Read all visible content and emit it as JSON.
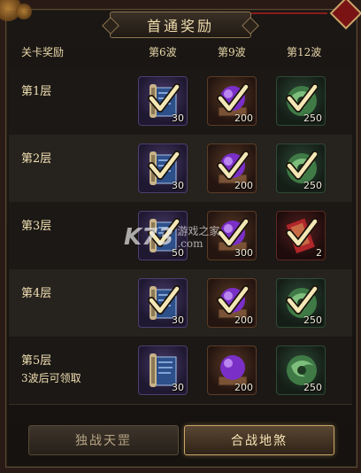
{
  "title": "首通奖励",
  "header": {
    "col0": "关卡奖励",
    "col1": "第6波",
    "col2": "第9波",
    "col3": "第12波"
  },
  "rows": [
    {
      "label": "第1层",
      "sub": "",
      "rewards": [
        {
          "icon": "blue-scroll-icon",
          "count": "30",
          "claimed": true
        },
        {
          "icon": "purple-orb-icon",
          "count": "200",
          "claimed": true
        },
        {
          "icon": "jade-ornament-icon",
          "count": "250",
          "claimed": true
        }
      ]
    },
    {
      "label": "第2层",
      "sub": "",
      "rewards": [
        {
          "icon": "blue-scroll-icon",
          "count": "30",
          "claimed": true
        },
        {
          "icon": "purple-orb-icon",
          "count": "200",
          "claimed": true
        },
        {
          "icon": "jade-ornament-icon",
          "count": "250",
          "claimed": true
        }
      ]
    },
    {
      "label": "第3层",
      "sub": "",
      "rewards": [
        {
          "icon": "blue-scroll-icon",
          "count": "50",
          "claimed": true
        },
        {
          "icon": "purple-orb-icon",
          "count": "300",
          "claimed": true
        },
        {
          "icon": "red-talisman-icon",
          "count": "2",
          "claimed": true
        }
      ]
    },
    {
      "label": "第4层",
      "sub": "",
      "rewards": [
        {
          "icon": "blue-scroll-icon",
          "count": "30",
          "claimed": true
        },
        {
          "icon": "purple-orb-icon",
          "count": "200",
          "claimed": true
        },
        {
          "icon": "jade-ornament-icon",
          "count": "250",
          "claimed": true
        }
      ]
    },
    {
      "label": "第5层",
      "sub": "3波后可领取",
      "rewards": [
        {
          "icon": "blue-scroll-icon",
          "count": "30",
          "claimed": false
        },
        {
          "icon": "purple-orb-icon",
          "count": "200",
          "claimed": false
        },
        {
          "icon": "jade-ornament-icon",
          "count": "250",
          "claimed": false
        }
      ]
    }
  ],
  "tabs": [
    {
      "label": "独战天罡",
      "active": false
    },
    {
      "label": "合战地煞",
      "active": true
    }
  ],
  "watermark": {
    "logo": "K73",
    "text": "游戏之家",
    "url": ".com"
  },
  "colors": {
    "gold": "#e8d6a8",
    "accent": "#c9a567",
    "check": "#f3e7b6"
  }
}
